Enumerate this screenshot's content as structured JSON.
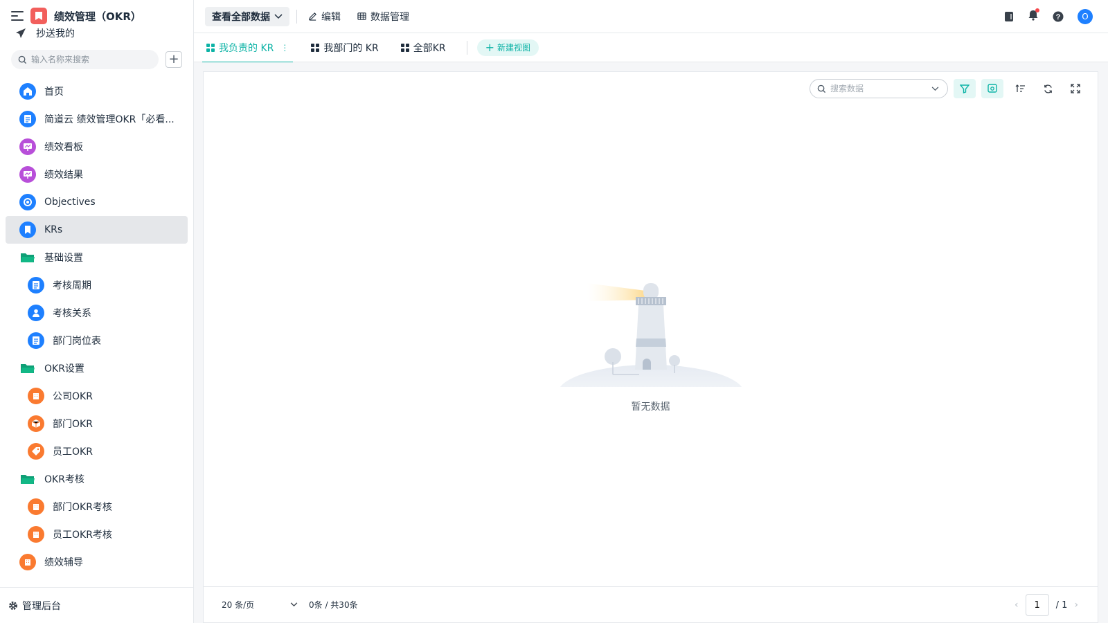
{
  "app": {
    "title": "绩效管理（OKR）",
    "cc_label": "抄送我的"
  },
  "sidebar": {
    "search_placeholder": "输入名称来搜索",
    "items": [
      {
        "label": "首页"
      },
      {
        "label": "简道云 绩效管理OKR「必看..."
      },
      {
        "label": "绩效看板"
      },
      {
        "label": "绩效结果"
      },
      {
        "label": "Objectives"
      },
      {
        "label": "KRs"
      },
      {
        "label": "基础设置"
      },
      {
        "label": "考核周期"
      },
      {
        "label": "考核关系"
      },
      {
        "label": "部门岗位表"
      },
      {
        "label": "OKR设置"
      },
      {
        "label": "公司OKR"
      },
      {
        "label": "部门OKR"
      },
      {
        "label": "员工OKR"
      },
      {
        "label": "OKR考核"
      },
      {
        "label": "部门OKR考核"
      },
      {
        "label": "员工OKR考核"
      },
      {
        "label": "绩效辅导"
      }
    ],
    "admin_label": "管理后台"
  },
  "topbar": {
    "view_select": "查看全部数据",
    "edit_label": "编辑",
    "data_manage_label": "数据管理",
    "avatar_letter": "O"
  },
  "tabs": [
    {
      "label": "我负责的 KR"
    },
    {
      "label": "我部门的 KR"
    },
    {
      "label": "全部KR"
    }
  ],
  "new_view_label": "新建视图",
  "toolbar": {
    "search_placeholder": "搜索数据"
  },
  "empty_text": "暂无数据",
  "footer": {
    "page_size": "20 条/页",
    "count": "0条 / 共30条",
    "current_page": "1",
    "total_pages": "/ 1"
  },
  "colors": {
    "accent": "#0db3a6",
    "blue": "#1e80ff",
    "purple": "#b84fd9",
    "orange": "#fa7a30",
    "folder": "#12b886"
  }
}
